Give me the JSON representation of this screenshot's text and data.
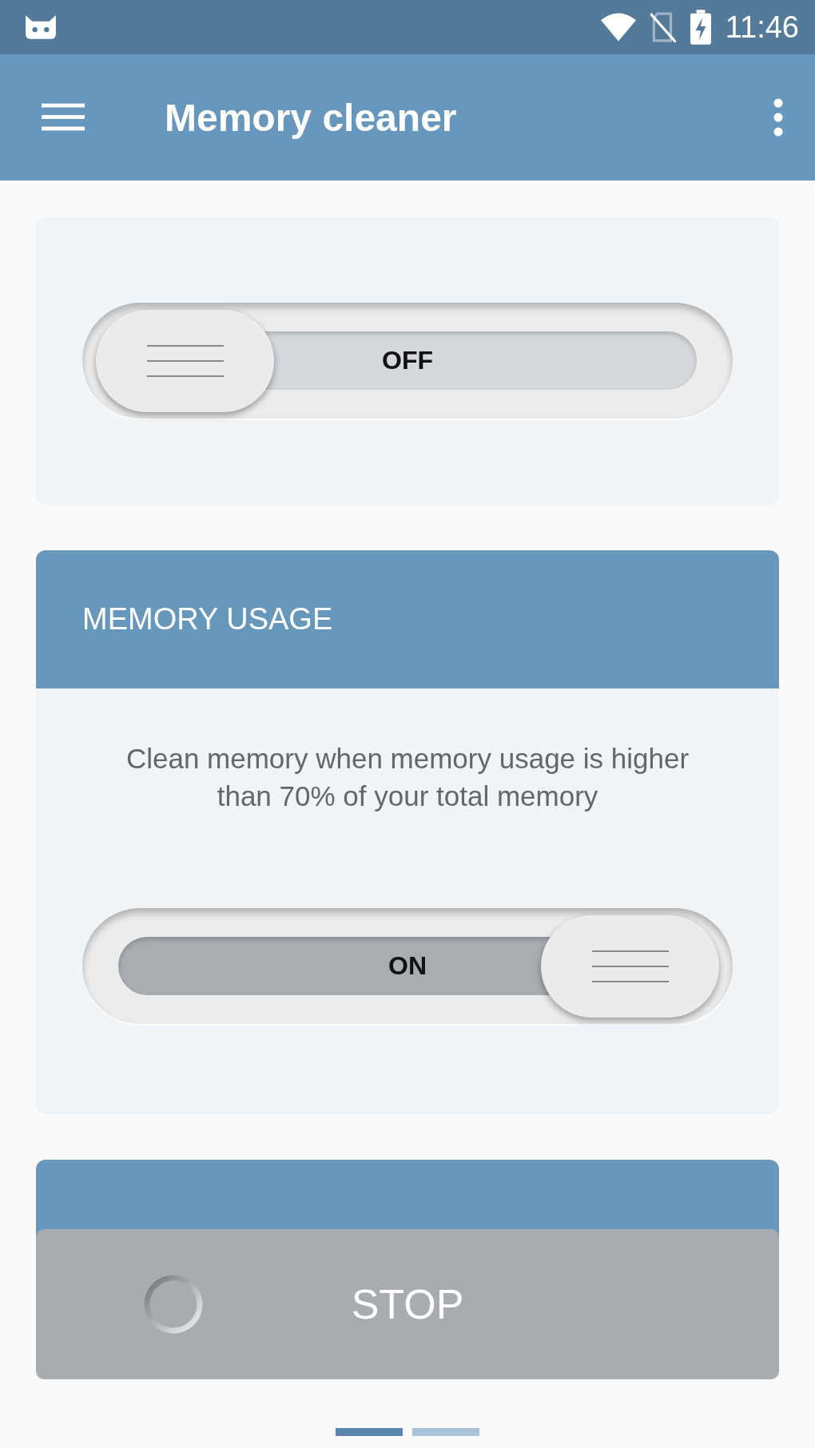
{
  "status_bar": {
    "time": "11:46"
  },
  "app_bar": {
    "title": "Memory cleaner"
  },
  "cards": [
    {
      "kind": "toggle",
      "toggle": {
        "label": "OFF",
        "on": false
      }
    },
    {
      "kind": "toggle",
      "header": "MEMORY USAGE",
      "description": "Clean memory when memory usage is higher than 70% of your total memory",
      "toggle": {
        "label": "ON",
        "on": true
      }
    },
    {
      "kind": "header"
    }
  ],
  "stop_button": {
    "label": "STOP"
  },
  "pager": [
    {
      "selected": true
    },
    {
      "selected": false
    }
  ]
}
